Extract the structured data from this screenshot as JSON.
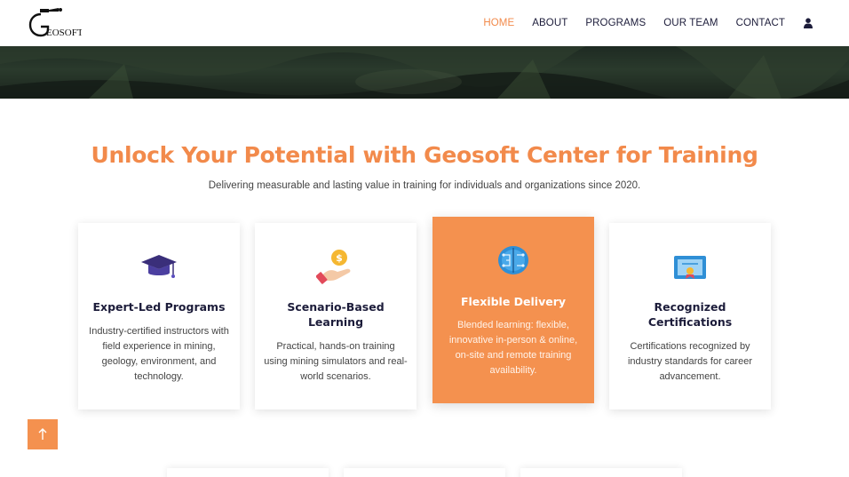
{
  "header": {
    "logo_text": "GEOSOFT",
    "nav": [
      {
        "label": "HOME",
        "active": true
      },
      {
        "label": "ABOUT",
        "active": false
      },
      {
        "label": "PROGRAMS",
        "active": false
      },
      {
        "label": "OUR TEAM",
        "active": false
      },
      {
        "label": "CONTACT",
        "active": false
      }
    ],
    "user_icon": "user-icon"
  },
  "intro": {
    "headline": "Unlock Your Potential with Geosoft Center for Training",
    "subline": "Delivering measurable and lasting value in training for individuals and organizations since 2020."
  },
  "cards": [
    {
      "icon": "graduation-cap-icon",
      "title": "Expert-Led Programs",
      "description": "Industry-certified instructors with field experience in mining, geology, environment, and technology."
    },
    {
      "icon": "coin-hand-icon",
      "title": "Scenario-Based Learning",
      "description": "Practical, hands-on training using mining simulators and real-world scenarios."
    },
    {
      "icon": "brain-circuit-icon",
      "title": "Flexible Delivery",
      "description": "Blended learning: flexible, innovative in-person & online, on-site and remote training availability.",
      "featured": true
    },
    {
      "icon": "certificate-icon",
      "title": "Recognized Certifications",
      "description": "Certifications recognized by industry standards for career advancement."
    }
  ],
  "colors": {
    "accent": "#f28a4b",
    "nav_text": "#1c1c3a",
    "featured_card": "#f4914f"
  },
  "back_to_top_icon": "arrow-up-icon"
}
